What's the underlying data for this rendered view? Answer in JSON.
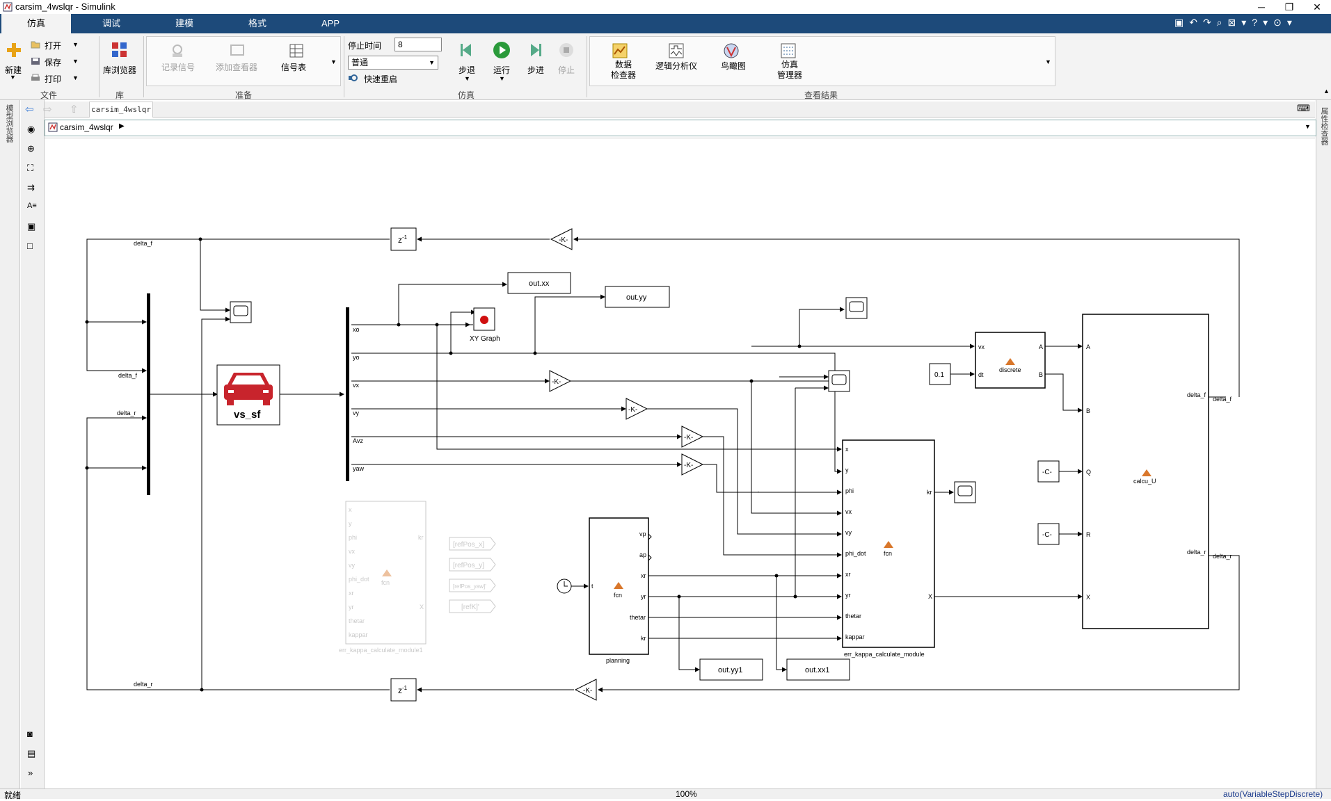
{
  "window": {
    "title": "carsim_4wslqr - Simulink"
  },
  "tabs": [
    "仿真",
    "调试",
    "建模",
    "格式",
    "APP"
  ],
  "ribbon": {
    "file": {
      "new": "新建",
      "open": "打开",
      "save": "保存",
      "print": "打印",
      "section": "文件"
    },
    "library": {
      "browser": "库浏览器",
      "section": "库"
    },
    "prepare": {
      "log_signals": "记录信号",
      "add_viewer": "添加查看器",
      "signal_table": "信号表",
      "section": "准备"
    },
    "simulate": {
      "stop_time_label": "停止时间",
      "stop_time_value": "8",
      "mode": "普通",
      "fast_restart": "快速重启",
      "step_back": "步退",
      "run": "运行",
      "step_forward": "步进",
      "stop": "停止",
      "section": "仿真"
    },
    "review": {
      "data_inspector": "数据\n检查器",
      "logic_analyzer": "逻辑分析仪",
      "bird_eye": "鸟瞰图",
      "sim_manager": "仿真\n管理器",
      "section": "查看结果"
    }
  },
  "side": {
    "model_browser": "模型浏览器",
    "property_inspector": "属性检查器"
  },
  "editor": {
    "tab_name": "carsim_4wslqr",
    "breadcrumb": "carsim_4wslqr"
  },
  "status": {
    "left": "就绪",
    "zoom": "100%",
    "solver": "auto(VariableStepDiscrete)"
  },
  "diagram": {
    "signals": {
      "delta_f": "delta_f",
      "delta_r": "delta_r"
    },
    "unit_delay": "z",
    "gain": "-K-",
    "const": "-C-",
    "const01": "0.1",
    "vs_sf": "vs_sf",
    "xy_graph": "XY Graph",
    "out_xx": "out.xx",
    "out_yy": "out.yy",
    "out_yy1": "out.yy1",
    "out_xx1": "out.xx1",
    "demux_ports": [
      "xo",
      "yo",
      "vx",
      "vy",
      "Avz",
      "yaw"
    ],
    "fcn": "fcn",
    "err_module": {
      "name": "err_kappa_calculate_module",
      "inputs": [
        "x",
        "y",
        "phi",
        "vx",
        "vy",
        "phi_dot",
        "xr",
        "yr",
        "thetar",
        "kappar"
      ],
      "outputs": [
        "kr",
        "X"
      ]
    },
    "err_module1": {
      "name": "err_kappa_calculate_module1",
      "inputs": [
        "x",
        "y",
        "phi",
        "vx",
        "vy",
        "phi_dot",
        "xr",
        "yr",
        "thetar",
        "kappar"
      ],
      "outputs": [
        "kr",
        "X"
      ]
    },
    "planning": {
      "name": "planning",
      "input": "t",
      "outputs": [
        "vp",
        "ap",
        "xr",
        "yr",
        "thetar",
        "kr"
      ]
    },
    "discrete": {
      "name": "discrete",
      "inputs": [
        "vx",
        "dt"
      ],
      "outputs": [
        "A",
        "B"
      ]
    },
    "calcu_u": {
      "name": "calcu_U",
      "inputs": [
        "A",
        "B",
        "Q",
        "R",
        "X"
      ],
      "outputs": [
        "delta_f",
        "delta_r"
      ]
    },
    "gotos": [
      "[refPos_x]",
      "[refPos_y]",
      "[refPos_yaw]'",
      "[refK]'"
    ]
  }
}
